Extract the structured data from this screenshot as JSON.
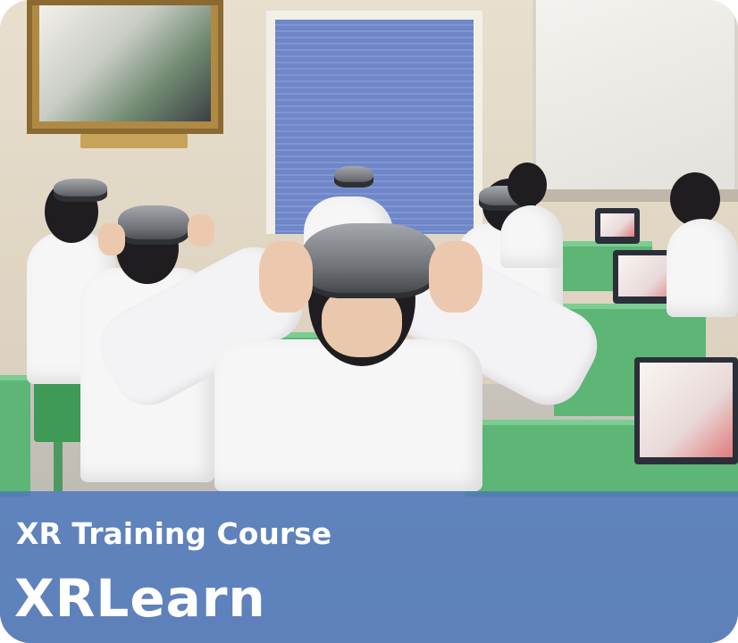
{
  "card": {
    "subtitle": "XR Training Course",
    "title": "XRLearn",
    "caption_color": "#4a76be",
    "image_description_icon": "classroom-vr-photo"
  }
}
